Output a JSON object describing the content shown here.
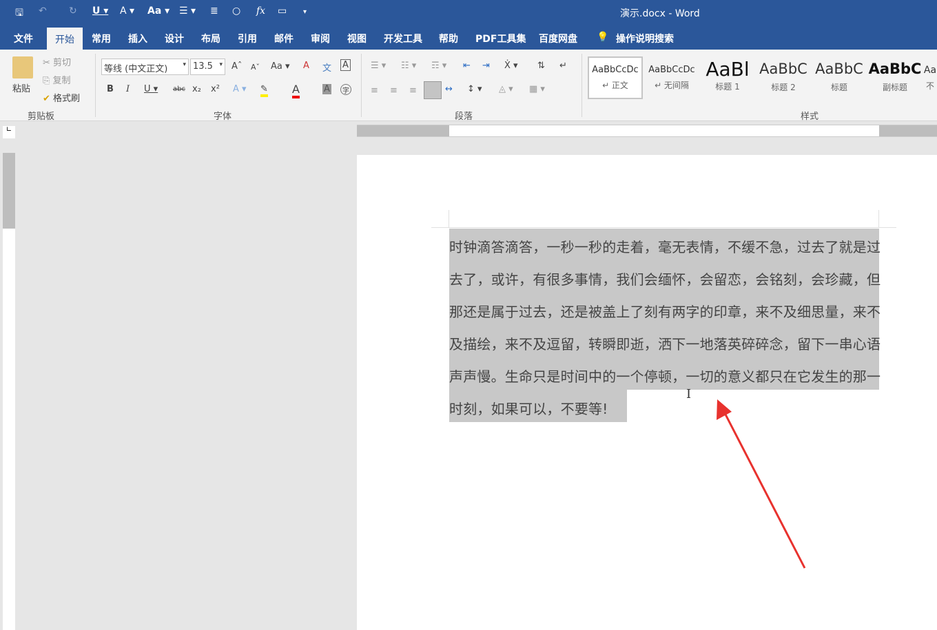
{
  "window": {
    "title": "演示.docx  -  Word"
  },
  "quick_access": [
    "save-icon",
    "undo-icon",
    "redo-icon",
    "underline-icon",
    "text-effect-icon",
    "change-case-icon",
    "bullets-icon",
    "align-icon",
    "shape-icon",
    "formula-icon",
    "comment-icon",
    "customize-icon"
  ],
  "tabs": [
    {
      "label": "文件"
    },
    {
      "label": "开始",
      "active": true
    },
    {
      "label": "常用"
    },
    {
      "label": "插入"
    },
    {
      "label": "设计"
    },
    {
      "label": "布局"
    },
    {
      "label": "引用"
    },
    {
      "label": "邮件"
    },
    {
      "label": "审阅"
    },
    {
      "label": "视图"
    },
    {
      "label": "开发工具"
    },
    {
      "label": "帮助"
    },
    {
      "label": "PDF工具集"
    },
    {
      "label": "百度网盘"
    }
  ],
  "search": {
    "label": "操作说明搜索"
  },
  "clipboard": {
    "paste": "粘贴",
    "cut": "剪切",
    "copy": "复制",
    "format_painter": "格式刷",
    "group": "剪贴板"
  },
  "font": {
    "name": "等线 (中文正文)",
    "size": "13.5",
    "group": "字体",
    "change_case": "Aa"
  },
  "paragraph": {
    "group": "段落"
  },
  "styles": {
    "group": "样式",
    "items": [
      {
        "preview": "AaBbCcDc",
        "name": "↵ 正文"
      },
      {
        "preview": "AaBbCcDc",
        "name": "↵ 无间隔"
      },
      {
        "preview": "AaBl",
        "name": "标题 1"
      },
      {
        "preview": "AaBbC",
        "name": "标题 2"
      },
      {
        "preview": "AaBbC",
        "name": "标题"
      },
      {
        "preview": "AaBbC",
        "name": "副标题"
      },
      {
        "preview": "Aa",
        "name": "不"
      }
    ]
  },
  "document": {
    "lines": [
      "时钟滴答滴答，一秒一秒的走着，毫无表情，不缓不急，过去了就是过",
      "去了，或许，有很多事情，我们会缅怀，会留恋，会铭刻，会珍藏，但",
      "那还是属于过去，还是被盖上了刻有两字的印章，来不及细思量，来不",
      "及描绘，来不及逗留，转瞬即逝，洒下一地落英碎碎念，留下一串心语",
      "声声慢。生命只是时间中的一个停顿，一切的意义都只在它发生的那一",
      "时刻，如果可以，不要等!"
    ],
    "selected": true
  },
  "colors": {
    "accent": "#2b579a",
    "selection": "#c8c8c8",
    "arrow": "#e8322e"
  }
}
